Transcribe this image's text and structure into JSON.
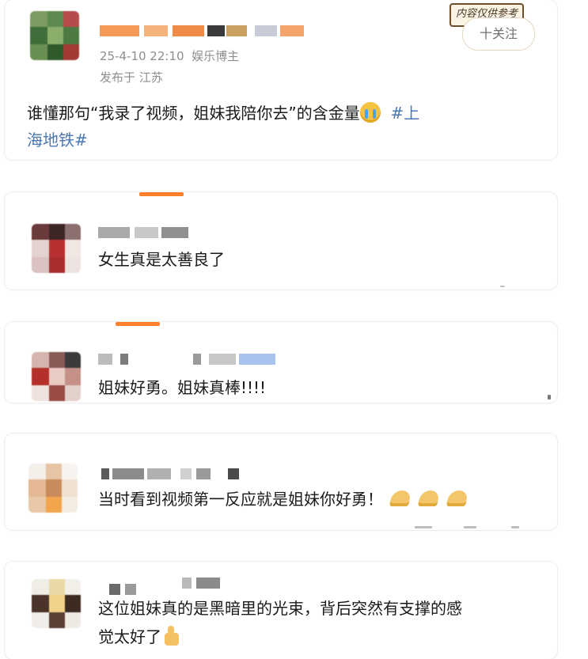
{
  "post": {
    "timestamp": "25-4-10 22:10",
    "category": "娱乐博主",
    "location": "发布于 江苏",
    "follow_label": "十关注",
    "stamp_text": "内容仅供参考",
    "body_text": "谁懂那句“我录了视频，姐妹我陪你去”的含金量",
    "emoji": "cry-face-emoji",
    "hashtag_line1": "#上",
    "hashtag_line2": "海地铁#"
  },
  "comments": [
    {
      "text": "女生真是太善良了"
    },
    {
      "text": "姐妹好勇。姐妹真棒!!!!"
    },
    {
      "text": "当时看到视频第一反应就是姐妹你好勇！",
      "emoji": "praying-hands-emoji"
    },
    {
      "text_line1": "这位姐妹真的是黑暗里的光束，背后突然有支撑的感",
      "text_line2": "觉太好了",
      "emoji": "thumbs-up-emoji"
    }
  ],
  "colors": {
    "hashtag": "#4a78b3",
    "accent_tab": "#ff7f2a",
    "meta_text": "#8e8e8e"
  }
}
